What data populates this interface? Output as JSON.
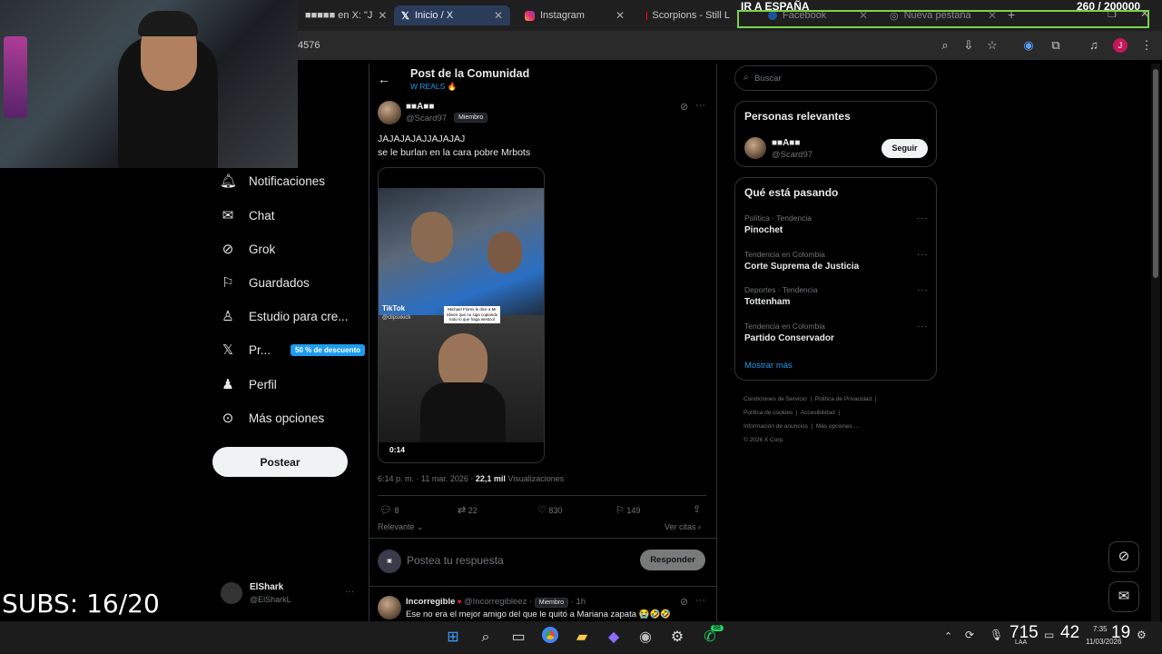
{
  "browser": {
    "tabs": [
      {
        "label": "■■■■■ en X: \"J",
        "active": false
      },
      {
        "label": "Inicio / X",
        "active": true
      },
      {
        "label": "Instagram",
        "active": false
      },
      {
        "label": "Scorpions - Still L",
        "active": false
      },
      {
        "label": "Facebook",
        "active": false
      },
      {
        "label": "Nueva pestaña",
        "active": false
      }
    ],
    "address_fragment": "4576"
  },
  "overlay": {
    "goal_title": "IR A ESPAÑA",
    "goal_counter": "260  / 200000",
    "subs": "SUBS: 16/20"
  },
  "left_nav": {
    "items": [
      {
        "label": "Notificaciones",
        "icon": "bell-icon"
      },
      {
        "label": "Chat",
        "icon": "mail-icon"
      },
      {
        "label": "Grok",
        "icon": "grok-icon"
      },
      {
        "label": "Guardados",
        "icon": "bookmark-icon"
      },
      {
        "label": "Estudio para cre...",
        "icon": "studio-icon"
      },
      {
        "label": "Pr...",
        "icon": "x-logo-icon",
        "badge": "50 % de descuento"
      },
      {
        "label": "Perfil",
        "icon": "person-icon"
      },
      {
        "label": "Más opciones",
        "icon": "more-circle-icon"
      }
    ],
    "post_button": "Postear",
    "account": {
      "name": "ElShark",
      "handle": "@ElSharkL"
    }
  },
  "post": {
    "header_title": "Post de la Comunidad",
    "community": "W REALS 🔥",
    "author_name": "■■A■■",
    "author_handle": "@Scard97",
    "member_badge": "Miembro",
    "text_line1": "JAJAJAJAJJAJAJAJ",
    "text_line2": "se le burlan en la cara pobre Mrbots",
    "video": {
      "duration": "0:14",
      "caption": "Michael Flores le dice a Mr Stiven que no siga copiando todo lo que haga westcol",
      "tiktok": "TikTok",
      "tiktok_user": "@clipsxkick"
    },
    "timestamp": "6:14 p. m. · 11 mar. 2026 · ",
    "views_count": "22,1 mil",
    "views_label": " Visualizaciones",
    "stats": {
      "replies": "8",
      "reposts": "22",
      "likes": "830",
      "bookmarks": "149"
    },
    "sort_label": "Relevante",
    "see_quotes": "Ver citas",
    "reply_placeholder": "Postea tu respuesta",
    "reply_button": "Responder"
  },
  "reply": {
    "name": "Incorregible",
    "handle": "@Incorregibleez",
    "badge": "Miembro",
    "time": "· 1h",
    "text": "Ese no era el mejor amigo del que le quitó a Mariana zapata 😭🤣🤣"
  },
  "sidebar": {
    "search_placeholder": "Buscar",
    "relevant_title": "Personas relevantes",
    "relevant_name": "■■A■■",
    "relevant_handle": "@Scard97",
    "follow_button": "Seguir",
    "trending_title": "Qué está pasando",
    "trends": [
      {
        "category": "Política · Tendencia",
        "name": "Pinochet"
      },
      {
        "category": "Tendencia en Colombia",
        "name": "Corte Suprema de Justicia"
      },
      {
        "category": "Deportes · Tendencia",
        "name": "Tottenham"
      },
      {
        "category": "Tendencia en Colombia",
        "name": "Partido Conservador"
      }
    ],
    "show_more": "Mostrar más",
    "footer": [
      "Condiciones de Servicio",
      "Política de Privacidad",
      "Política de cookies",
      "Accesibilidad",
      "Información de anuncios",
      "Más opciones ...",
      "© 2026 X Corp."
    ]
  },
  "taskbar": {
    "whatsapp_badge": "88",
    "clock_big1": "715",
    "clock_big2": "42",
    "clock_big3": "19",
    "time": "7:35",
    "date": "11/03/2026",
    "lang": "LAA"
  },
  "colors": {
    "accent": "#1d9bf0",
    "post_button_bg": "#eff3f4",
    "goal_border": "#7bd24a"
  }
}
